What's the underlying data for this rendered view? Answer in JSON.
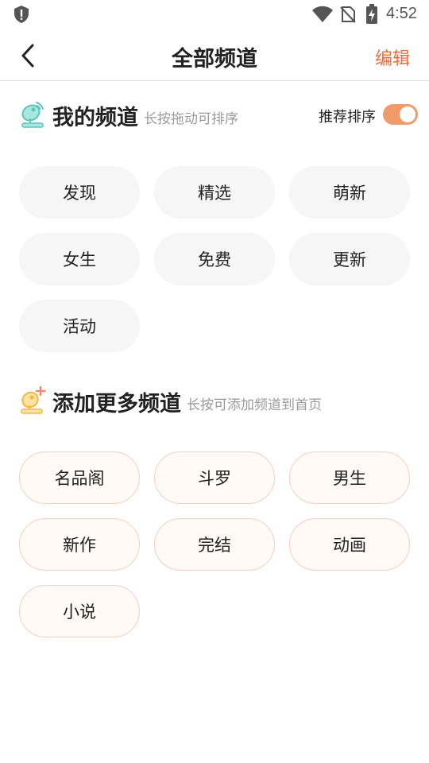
{
  "status": {
    "time": "4:52"
  },
  "nav": {
    "title": "全部频道",
    "edit_label": "编辑"
  },
  "my_channels": {
    "title": "我的频道",
    "hint": "长按拖动可排序",
    "sort_label": "推荐排序",
    "sort_enabled": true,
    "items": [
      "发现",
      "精选",
      "萌新",
      "女生",
      "免费",
      "更新",
      "活动"
    ]
  },
  "more_channels": {
    "title": "添加更多频道",
    "hint": "长按可添加频道到首页",
    "items": [
      "名品阁",
      "斗罗",
      "男生",
      "新作",
      "完结",
      "动画",
      "小说"
    ]
  },
  "colors": {
    "accent": "#f26a3c",
    "toggle_on": "#f19a6a",
    "chip_mine_bg": "#f6f6f6",
    "chip_more_bg": "#fffaf5",
    "chip_more_border": "#f7cfc4"
  }
}
